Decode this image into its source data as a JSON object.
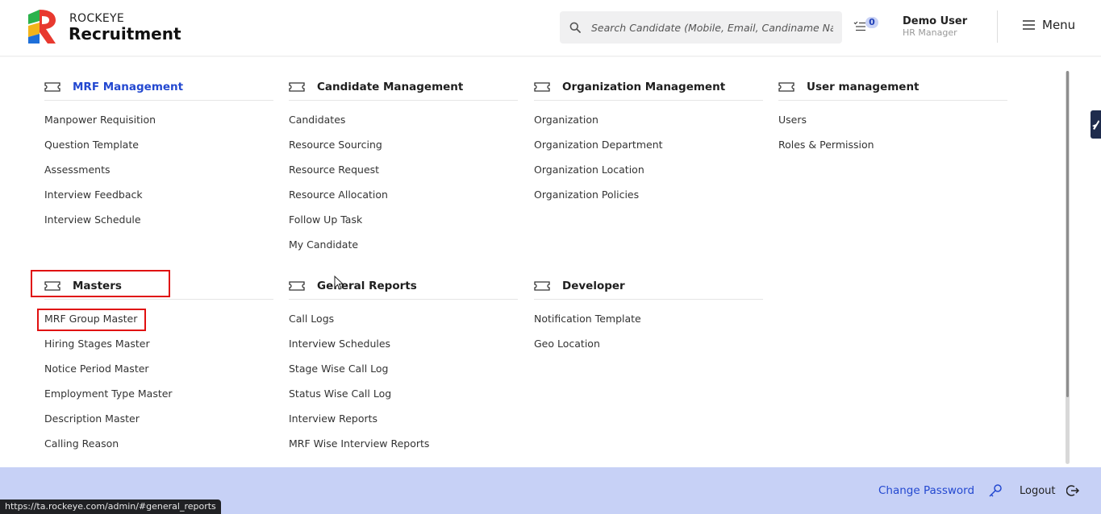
{
  "brand": {
    "top": "ROCKEYE",
    "main": "Recruitment"
  },
  "search": {
    "placeholder": "Search Candidate (Mobile, Email, Candiname Name)"
  },
  "notifications": {
    "count": "0"
  },
  "user": {
    "name": "Demo User",
    "role": "HR Manager"
  },
  "menu": {
    "label": "Menu"
  },
  "sections": {
    "mrf": {
      "title": "MRF Management",
      "items": [
        "Manpower Requisition",
        "Question Template",
        "Assessments",
        "Interview Feedback",
        "Interview Schedule"
      ]
    },
    "candidate": {
      "title": "Candidate Management",
      "items": [
        "Candidates",
        "Resource Sourcing",
        "Resource Request",
        "Resource Allocation",
        "Follow Up Task",
        "My Candidate"
      ]
    },
    "organization": {
      "title": "Organization Management",
      "items": [
        "Organization",
        "Organization Department",
        "Organization Location",
        "Organization Policies"
      ]
    },
    "user": {
      "title": "User management",
      "items": [
        "Users",
        "Roles & Permission"
      ]
    },
    "masters": {
      "title": "Masters",
      "items": [
        "MRF Group Master",
        "Hiring Stages Master",
        "Notice Period Master",
        "Employment Type Master",
        "Description Master",
        "Calling Reason"
      ]
    },
    "reports": {
      "title": "General Reports",
      "items": [
        "Call Logs",
        "Interview Schedules",
        "Stage Wise Call Log",
        "Status Wise Call Log",
        "Interview Reports",
        "MRF Wise Interview Reports"
      ]
    },
    "developer": {
      "title": "Developer",
      "items": [
        "Notification Template",
        "Geo Location"
      ]
    }
  },
  "footer": {
    "change_password": "Change Password",
    "logout": "Logout"
  },
  "status_bar": {
    "url": "https://ta.rockeye.com/admin/#general_reports"
  },
  "colors": {
    "accent": "#2348d0",
    "footer_bg": "#c7d1f6",
    "highlight": "#e01010"
  },
  "icons": {
    "section": "ticket-icon",
    "search": "search-icon",
    "notifications": "list-check-icon",
    "menu": "hamburger-icon",
    "key": "key-icon",
    "logout": "logout-icon"
  }
}
